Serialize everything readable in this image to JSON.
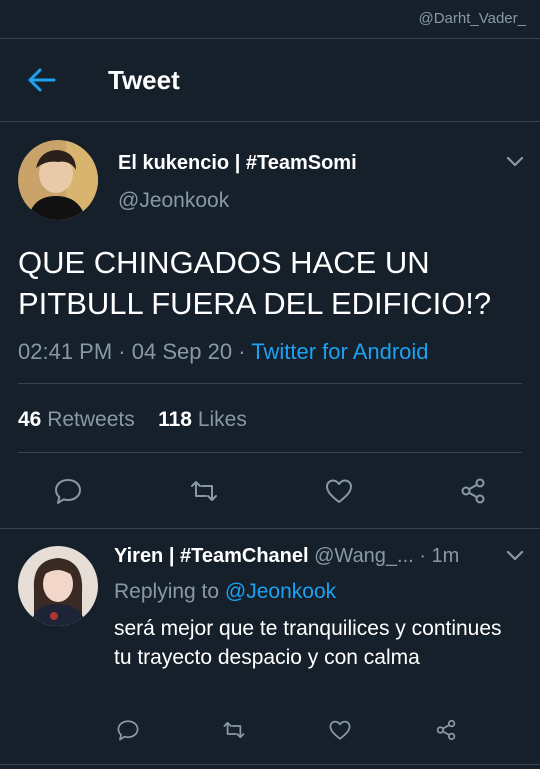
{
  "watermark": "@Darht_Vader_",
  "header": {
    "title": "Tweet"
  },
  "tweet": {
    "author_name": "El kukencio | #TeamSomi",
    "author_handle": "@Jeonkook",
    "text": "QUE CHINGADOS HACE UN PITBULL FUERA DEL EDIFICIO!?",
    "time": "02:41 PM",
    "date": "04 Sep 20",
    "source": "Twitter for Android",
    "retweets_count": "46",
    "retweets_label": "Retweets",
    "likes_count": "118",
    "likes_label": "Likes"
  },
  "reply": {
    "author_name": "Yiren | #TeamChanel",
    "author_handle": "@Wang_...",
    "time_ago": "1m",
    "replying_prefix": "Replying to",
    "replying_to": "@Jeonkook",
    "text": "será mejor que te tranquilices y continues tu trayecto despacio y con calma"
  },
  "icons": {
    "back": "back-arrow-icon",
    "chevron": "chevron-down-icon",
    "reply": "reply-icon",
    "retweet": "retweet-icon",
    "like": "heart-icon",
    "share": "share-icon"
  },
  "colors": {
    "background": "#15202b",
    "accent": "#1da1f2",
    "secondary_text": "#8899a6",
    "divider": "#38444d"
  }
}
